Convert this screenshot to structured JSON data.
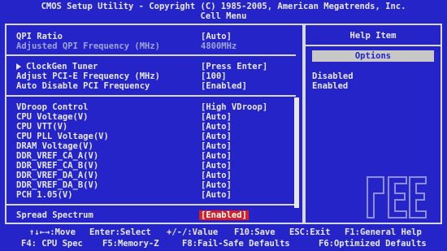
{
  "header": {
    "title": "CMOS Setup Utility - Copyright (C) 1985-2005, American Megatrends, Inc.",
    "subtitle": "Cell Menu"
  },
  "settings": [
    {
      "label": "QPI Ratio",
      "value": "[Auto]"
    },
    {
      "label": "Adjusted QPI Frequency (MHz)",
      "value": "4800MHz"
    },
    {
      "label": "ClockGen Tuner",
      "value": "[Press Enter]"
    },
    {
      "label": "Adjust PCI-E Frequency (MHz)",
      "value": "[100]"
    },
    {
      "label": "Auto Disable PCI Frequency",
      "value": "[Enabled]"
    },
    {
      "label": "VDroop Control",
      "value": "[High VDroop]"
    },
    {
      "label": "CPU Voltage(V)",
      "value": "[Auto]"
    },
    {
      "label": "CPU VTT(V)",
      "value": "[Auto]"
    },
    {
      "label": "CPU PLL Voltage(V)",
      "value": "[Auto]"
    },
    {
      "label": "DRAM Voltage(V)",
      "value": "[Auto]"
    },
    {
      "label": "DDR_VREF_CA_A(V)",
      "value": "[Auto]"
    },
    {
      "label": "DDR_VREF_CA_B(V)",
      "value": "[Auto]"
    },
    {
      "label": "DDR_VREF_DA_A(V)",
      "value": "[Auto]"
    },
    {
      "label": "DDR_VREF_DA_B(V)",
      "value": "[Auto]"
    },
    {
      "label": "PCH 1.05(V)",
      "value": "[Auto]"
    },
    {
      "label": "Spread Spectrum",
      "value": "[Enabled]"
    }
  ],
  "help": {
    "title": "Help Item",
    "options_label": "Options",
    "options": [
      "Disabled",
      "Enabled"
    ]
  },
  "footer": {
    "row1": [
      "↑↓←→:Move",
      "Enter:Select",
      "+/-/:Value",
      "F10:Save",
      "ESC:Exit",
      "F1:General Help"
    ],
    "row2": [
      "F4: CPU Spec",
      "F5:Memory-Z",
      "F8:Fail-Safe Defaults",
      "F6:Optimized Defaults"
    ]
  },
  "colors": {
    "background": "#2424c8",
    "highlight": "#d42020",
    "text": "#e8e8e8"
  }
}
